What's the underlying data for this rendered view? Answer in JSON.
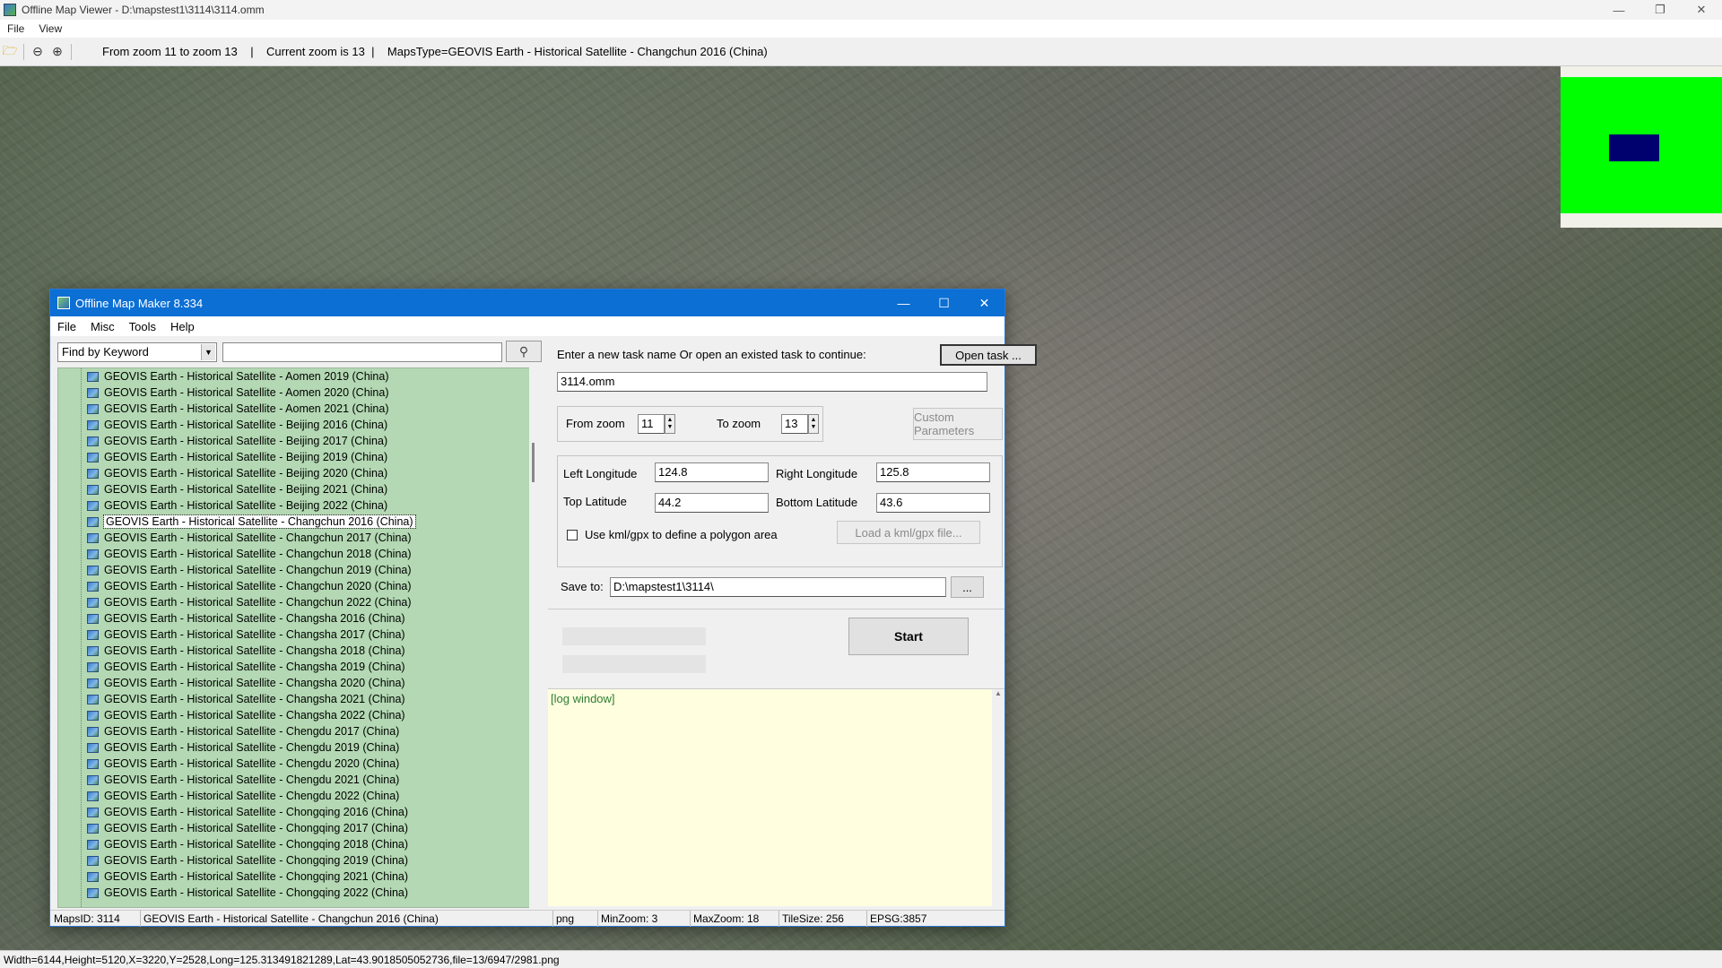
{
  "window": {
    "title": "Offline Map Viewer - D:\\mapstest1\\3114\\3114.omm",
    "menu": [
      "File",
      "View"
    ],
    "controls": {
      "minimize": "—",
      "restore": "❐",
      "close": "✕"
    }
  },
  "toolbar": {
    "info": "From zoom 11 to zoom 13    |    Current zoom is 13  |    MapsType=GEOVIS Earth - Historical Satellite - Changchun 2016 (China)",
    "icons": [
      "open-folder-icon",
      "zoom-out-icon",
      "zoom-in-icon"
    ]
  },
  "statusbar": {
    "text": "Width=6144,Height=5120,X=3220,Y=2528,Long=125.313491821289,Lat=43.9018505052736,file=13/6947/2981.png"
  },
  "overview": {
    "frame_color": "#00ff00",
    "viewport_color": "#00006e"
  },
  "dialog": {
    "title": "Offline Map Maker 8.334",
    "controls": {
      "minimize": "—",
      "maximize": "☐",
      "close": "✕"
    },
    "menu": [
      "File",
      "Misc",
      "Tools",
      "Help"
    ],
    "find": {
      "selected": "Find by Keyword",
      "search_value": ""
    },
    "tree": {
      "items": [
        "GEOVIS Earth - Historical Satellite - Aomen 2019 (China)",
        "GEOVIS Earth - Historical Satellite - Aomen 2020 (China)",
        "GEOVIS Earth - Historical Satellite - Aomen 2021 (China)",
        "GEOVIS Earth - Historical Satellite - Beijing 2016 (China)",
        "GEOVIS Earth - Historical Satellite - Beijing 2017 (China)",
        "GEOVIS Earth - Historical Satellite - Beijing 2019 (China)",
        "GEOVIS Earth - Historical Satellite - Beijing 2020 (China)",
        "GEOVIS Earth - Historical Satellite - Beijing 2021 (China)",
        "GEOVIS Earth - Historical Satellite - Beijing 2022 (China)",
        "GEOVIS Earth - Historical Satellite - Changchun 2016 (China)",
        "GEOVIS Earth - Historical Satellite - Changchun 2017 (China)",
        "GEOVIS Earth - Historical Satellite - Changchun 2018 (China)",
        "GEOVIS Earth - Historical Satellite - Changchun 2019 (China)",
        "GEOVIS Earth - Historical Satellite - Changchun 2020 (China)",
        "GEOVIS Earth - Historical Satellite - Changchun 2022 (China)",
        "GEOVIS Earth - Historical Satellite - Changsha 2016 (China)",
        "GEOVIS Earth - Historical Satellite - Changsha 2017 (China)",
        "GEOVIS Earth - Historical Satellite - Changsha 2018 (China)",
        "GEOVIS Earth - Historical Satellite - Changsha 2019 (China)",
        "GEOVIS Earth - Historical Satellite - Changsha 2020 (China)",
        "GEOVIS Earth - Historical Satellite - Changsha 2021 (China)",
        "GEOVIS Earth - Historical Satellite - Changsha 2022 (China)",
        "GEOVIS Earth - Historical Satellite - Chengdu 2017 (China)",
        "GEOVIS Earth - Historical Satellite - Chengdu 2019 (China)",
        "GEOVIS Earth - Historical Satellite - Chengdu 2020 (China)",
        "GEOVIS Earth - Historical Satellite - Chengdu 2021 (China)",
        "GEOVIS Earth - Historical Satellite - Chengdu 2022 (China)",
        "GEOVIS Earth - Historical Satellite - Chongqing 2016 (China)",
        "GEOVIS Earth - Historical Satellite - Chongqing 2017 (China)",
        "GEOVIS Earth - Historical Satellite - Chongqing 2018 (China)",
        "GEOVIS Earth - Historical Satellite - Chongqing 2019 (China)",
        "GEOVIS Earth - Historical Satellite - Chongqing 2021 (China)",
        "GEOVIS Earth - Historical Satellite - Chongqing 2022 (China)"
      ],
      "selected_index": 9,
      "background": "#b3d8b3"
    },
    "task": {
      "prompt": "Enter a new task name Or open an existed task to continue:",
      "open_button": "Open task ...",
      "name_value": "3114.omm"
    },
    "zoom": {
      "from_label": "From zoom",
      "from_value": "11",
      "to_label": "To zoom",
      "to_value": "13",
      "custom_button": "Custom Parameters"
    },
    "bounds": {
      "left_lon_label": "Left Longitude",
      "left_lon_value": "124.8",
      "right_lon_label": "Right Longitude",
      "right_lon_value": "125.8",
      "top_lat_label": "Top Latitude",
      "top_lat_value": "44.2",
      "bottom_lat_label": "Bottom Latitude",
      "bottom_lat_value": "43.6",
      "kml_label": "Use kml/gpx to define a polygon area",
      "kml_button": "Load a kml/gpx file..."
    },
    "save": {
      "label": "Save to:",
      "value": "D:\\mapstest1\\3114\\",
      "browse_button": "..."
    },
    "start_button": "Start",
    "log": {
      "text": "[log window]"
    },
    "status": {
      "maps_id": "MapsID: 3114",
      "map_name": "GEOVIS Earth - Historical Satellite - Changchun 2016 (China)",
      "format": "png",
      "min_zoom": "MinZoom: 3",
      "max_zoom": "MaxZoom: 18",
      "tile_size": "TileSize: 256",
      "epsg": "EPSG:3857"
    }
  }
}
